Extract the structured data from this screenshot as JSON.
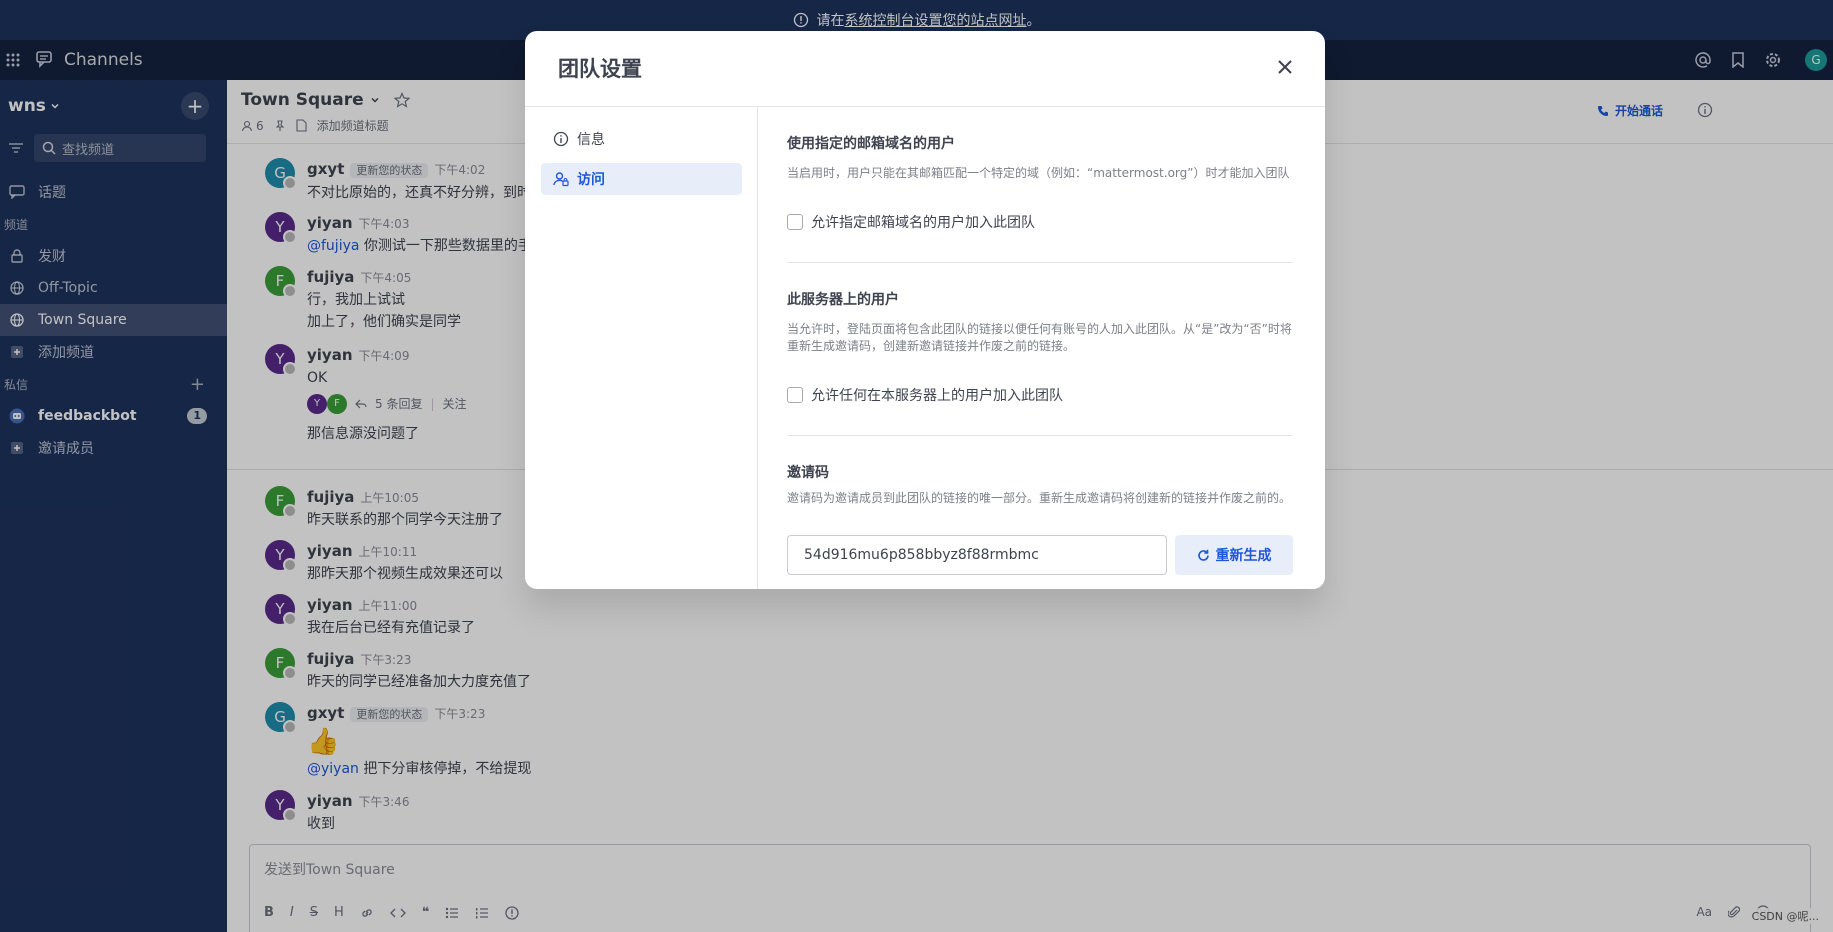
{
  "banner": {
    "prefix": "请在",
    "link": "系统控制台设置您的站点网址",
    "suffix": "。"
  },
  "globalbar": {
    "app_name": "Channels",
    "avatar_initial": "G"
  },
  "sidebar": {
    "team_name": "wns",
    "search_placeholder": "查找频道",
    "threads_label": "话题",
    "channels_section": "频道",
    "channels": [
      {
        "label": "发财"
      },
      {
        "label": "Off-Topic"
      },
      {
        "label": "Town Square"
      },
      {
        "label": "添加频道"
      }
    ],
    "dm_section": "私信",
    "dm_items": [
      {
        "label": "feedbackbot",
        "badge": "1"
      },
      {
        "label": "邀请成员"
      }
    ]
  },
  "channel": {
    "title": "Town Square",
    "member_count": "6",
    "add_header": "添加频道标题",
    "call_label": "开始通话",
    "composer_placeholder": "发送到Town Square"
  },
  "messages": [
    {
      "initial": "G",
      "name": "gxyt",
      "status_chip": "更新您的状态",
      "time": "下午4:02",
      "text": "不对比原始的，还真不好分辨，到时..."
    },
    {
      "initial": "Y",
      "name": "yiyan",
      "time": "下午4:03",
      "mention": "@fujiya",
      "text": " 你测试一下那些数据里的手机..."
    },
    {
      "initial": "F",
      "name": "fujiya",
      "time": "下午4:05",
      "text": "行，我加上试试",
      "text2": "加上了，他们确实是同学"
    },
    {
      "initial": "Y",
      "name": "yiyan",
      "time": "下午4:09",
      "text": "OK",
      "reply_count": "5 条回复",
      "follow": "关注",
      "text2": "那信息源没问题了"
    },
    {
      "initial": "F",
      "name": "fujiya",
      "time": "上午10:05",
      "text": "昨天联系的那个同学今天注册了"
    },
    {
      "initial": "Y",
      "name": "yiyan",
      "time": "上午10:11",
      "text": "那昨天那个视频生成效果还可以"
    },
    {
      "initial": "Y",
      "name": "yiyan",
      "time": "上午11:00",
      "text": "我在后台已经有充值记录了"
    },
    {
      "initial": "F",
      "name": "fujiya",
      "time": "下午3:23",
      "text": "昨天的同学已经准备加大力度充值了"
    },
    {
      "initial": "G",
      "name": "gxyt",
      "status_chip": "更新您的状态",
      "time": "下午3:23",
      "emoji": "👍",
      "mention": "@yiyan",
      "text": " 把下分审核停掉，不给提现"
    },
    {
      "initial": "Y",
      "name": "yiyan",
      "time": "下午3:46",
      "text": "收到"
    }
  ],
  "composer": {
    "font_label": "Aa",
    "watermark": "CSDN @呢..."
  },
  "modal": {
    "title": "团队设置",
    "nav": [
      {
        "label": "信息"
      },
      {
        "label": "访问"
      }
    ],
    "sections": {
      "domains_title": "使用指定的邮箱域名的用户",
      "domains_desc": "当启用时，用户只能在其邮箱匹配一个特定的域（例如：“mattermost.org”）时才能加入团队",
      "domains_check": "允许指定邮箱域名的用户加入此团队",
      "server_title": "此服务器上的用户",
      "server_desc": "当允许时，登陆页面将包含此团队的链接以便任何有账号的人加入此团队。从“是”改为“否”时将重新生成邀请码，创建新邀请链接并作废之前的链接。",
      "server_check": "允许任何在本服务器上的用户加入此团队",
      "invite_title": "邀请码",
      "invite_desc": "邀请码为邀请成员到此团队的链接的唯一部分。重新生成邀请码将创建新的链接并作废之前的。",
      "invite_code": "54d916mu6p858bbyz8f88rmbmc",
      "regen_label": "重新生成"
    }
  }
}
